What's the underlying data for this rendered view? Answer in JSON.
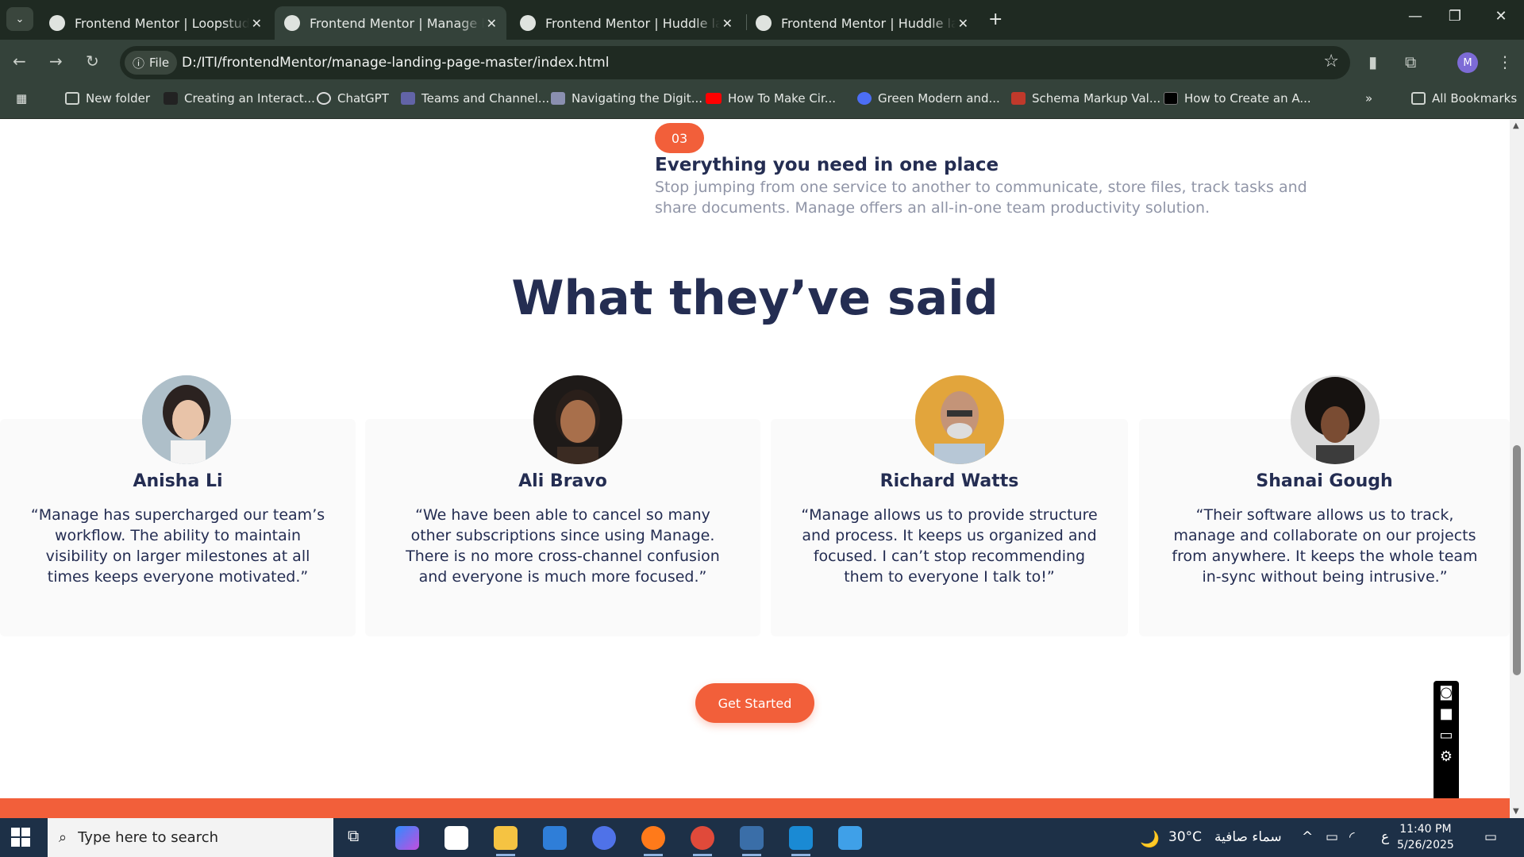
{
  "browser": {
    "tabs": [
      {
        "title": "Frontend Mentor | Loopstudios",
        "active": false
      },
      {
        "title": "Frontend Mentor | Manage landing page",
        "active": true
      },
      {
        "title": "Frontend Mentor | Huddle landing page",
        "active": false
      },
      {
        "title": "Frontend Mentor | Huddle landing page",
        "active": false
      }
    ],
    "omnibox": {
      "scheme_chip": "File",
      "url": "D:/ITI/frontendMentor/manage-landing-page-master/index.html"
    },
    "profile_initial": "M",
    "bookmarks": [
      {
        "label": "New folder",
        "icon": "folder-icon"
      },
      {
        "label": "Creating an Interact...",
        "icon": "cs-icon"
      },
      {
        "label": "ChatGPT",
        "icon": "chatgpt-icon"
      },
      {
        "label": "Teams and Channel...",
        "icon": "teams-icon"
      },
      {
        "label": "Navigating the Digit...",
        "icon": "layers-icon"
      },
      {
        "label": "How To Make Cir...",
        "icon": "youtube-icon"
      },
      {
        "label": "Green Modern and...",
        "icon": "canva-icon"
      },
      {
        "label": "Schema Markup Val...",
        "icon": "schema-icon"
      },
      {
        "label": "How to Create an A...",
        "icon": "dev-icon"
      }
    ],
    "all_bookmarks": "All Bookmarks"
  },
  "page": {
    "step": {
      "number": "03",
      "title": "Everything you need in one place",
      "description": "Stop jumping from one service to another to communicate, store files, track tasks and share documents. Manage offers an all-in-one team productivity solution."
    },
    "testimonials_heading": "What they’ve said",
    "testimonials": [
      {
        "name": "Anisha Li",
        "quote": "“Manage has supercharged our team’s workflow. The ability to maintain visibility on larger milestones at all times keeps everyone motivated.”"
      },
      {
        "name": "Ali Bravo",
        "quote": "“We have been able to cancel so many other subscriptions since using Manage. There is no more cross-channel confusion and everyone is much more focused.”"
      },
      {
        "name": "Richard Watts",
        "quote": "“Manage allows us to provide structure and process. It keeps us organized and focused. I can’t stop recommending them to everyone I talk to!”"
      },
      {
        "name": "Shanai Gough",
        "quote": "“Their software allows us to track, manage and collaborate on our projects from anywhere. It keeps the whole team in-sync without being intrusive.”"
      }
    ],
    "cta_label": "Get Started",
    "accent_color": "#f25f3a",
    "heading_color": "#242d52"
  },
  "taskbar": {
    "search_placeholder": "Type here to search",
    "weather": "30°C",
    "weather_desc": "سماء صافية",
    "lang": "ع",
    "time": "11:40 PM",
    "date": "5/26/2025"
  }
}
